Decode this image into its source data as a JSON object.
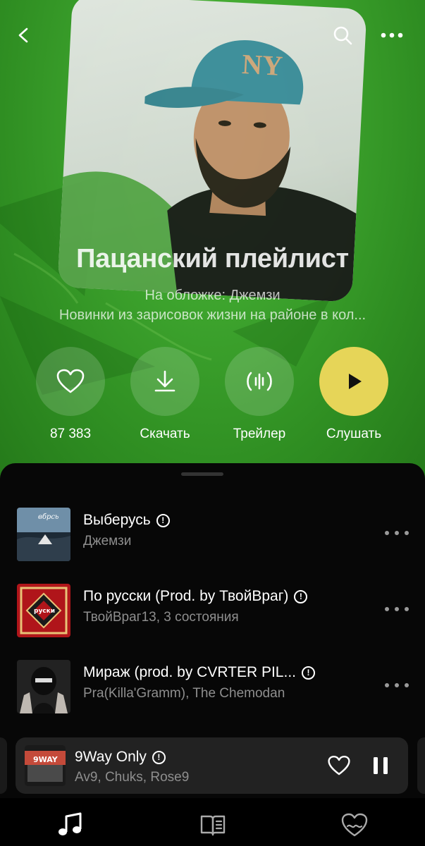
{
  "header": {
    "back_icon": "chevron-left-icon",
    "search_icon": "search-icon",
    "more_icon": "more-horizontal-icon"
  },
  "playlist": {
    "title": "Пацанский плейлист",
    "cover_credit": "На обложке: Джемзи",
    "description": "Новинки из зарисовок жизни на районе в кол..."
  },
  "actions": [
    {
      "label": "87 383",
      "icon": "heart-icon"
    },
    {
      "label": "Скачать",
      "icon": "download-icon"
    },
    {
      "label": "Трейлер",
      "icon": "trailer-icon"
    },
    {
      "label": "Слушать",
      "icon": "play-icon"
    }
  ],
  "tracks": [
    {
      "title": "Выберусь",
      "artist": "Джемзи",
      "explicit": "!"
    },
    {
      "title": "По русски (Prod. by ТвойВраг)",
      "artist": "ТвойВраг13, 3 состояния",
      "explicit": "!"
    },
    {
      "title": "Мираж (prod. by CVRTER PIL...",
      "artist": "Pra(Killa'Gramm), The Chemodan",
      "explicit": "!"
    }
  ],
  "now_playing": {
    "title": "9Way Only",
    "artists": "Av9, Chuks, Rose9",
    "explicit": "!"
  },
  "tabbar": {
    "items": [
      "music-note-icon",
      "book-icon",
      "heart-wave-icon"
    ]
  },
  "colors": {
    "accent_green": "#3ea52e",
    "play_yellow": "#e6d558",
    "sheet_bg": "#070707"
  }
}
